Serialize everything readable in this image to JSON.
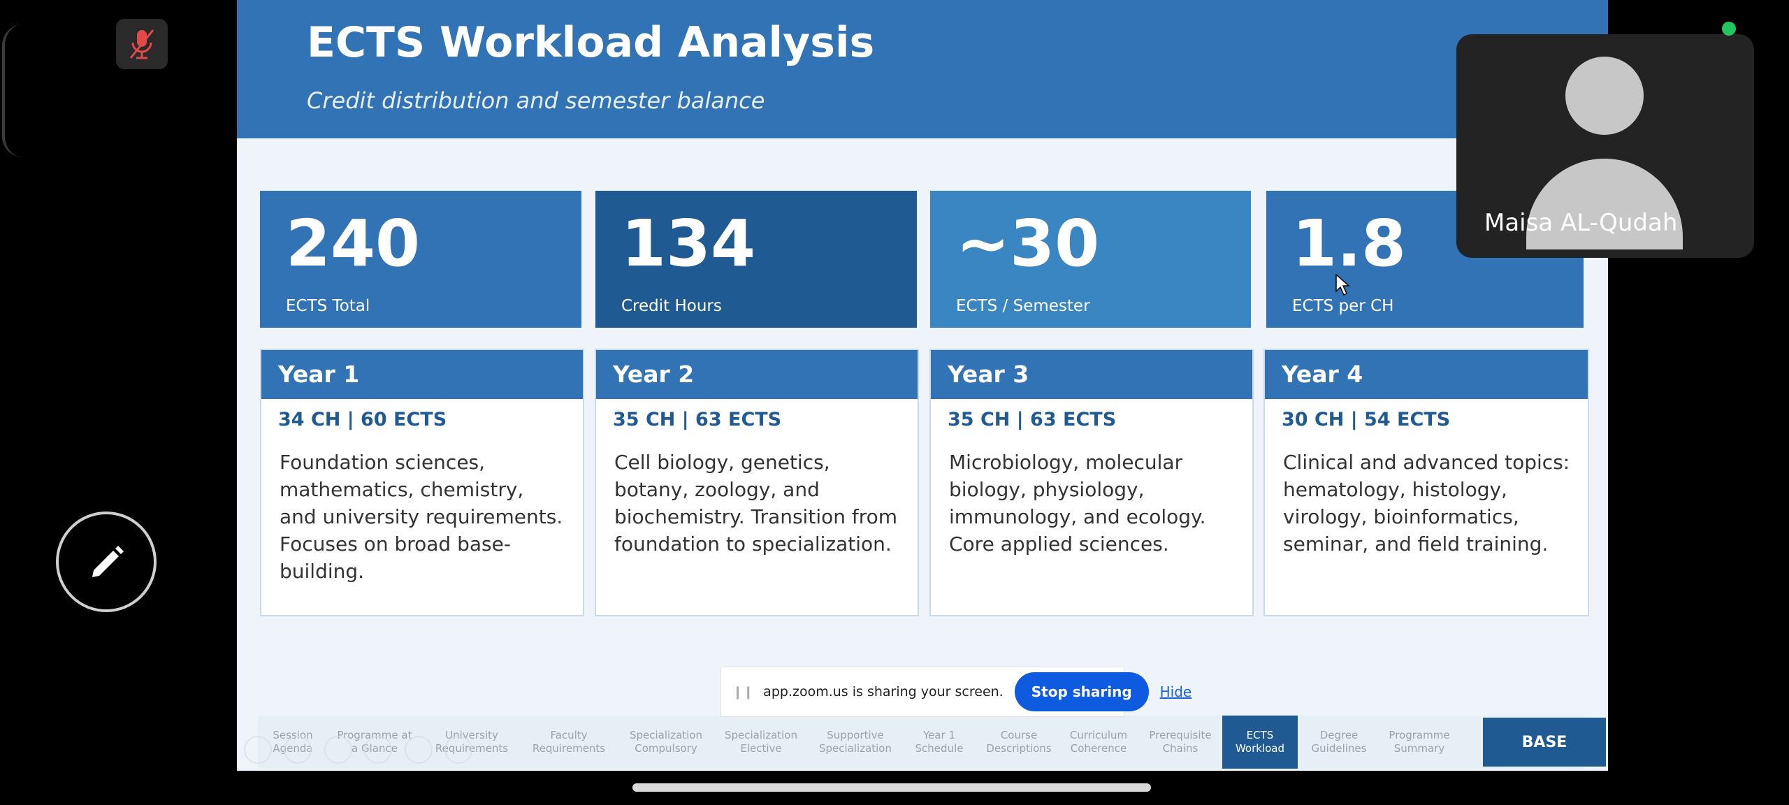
{
  "slide": {
    "title": "ECTS Workload Analysis",
    "subtitle": "Credit distribution and semester balance",
    "stats": [
      {
        "value": "240",
        "label": "ECTS Total",
        "color": "#3273b5"
      },
      {
        "value": "134",
        "label": "Credit Hours",
        "color": "#1f5a92"
      },
      {
        "value": "~30",
        "label": "ECTS / Semester",
        "color": "#3a86c2"
      },
      {
        "value": "1.8",
        "label": "ECTS per CH",
        "color": "#3273b5"
      }
    ],
    "years": [
      {
        "title": "Year 1",
        "credits": "34 CH | 60 ECTS",
        "description": "Foundation sciences, mathematics, chemistry, and university requirements. Focuses on broad base-building."
      },
      {
        "title": "Year 2",
        "credits": "35 CH | 63 ECTS",
        "description": "Cell biology, genetics, botany, zoology, and biochemistry. Transition from foundation to specialization."
      },
      {
        "title": "Year 3",
        "credits": "35 CH | 63 ECTS",
        "description": "Microbiology, molecular biology, physiology, immunology, and ecology. Core applied sciences."
      },
      {
        "title": "Year 4",
        "credits": "30 CH | 54 ECTS",
        "description": "Clinical and advanced topics: hematology, histology, virology, bioinformatics, seminar, and field training."
      }
    ]
  },
  "nav": {
    "items": [
      {
        "label": "Session Agenda"
      },
      {
        "label": "Programme at a Glance"
      },
      {
        "label": "University Requirements"
      },
      {
        "label": "Faculty Requirements"
      },
      {
        "label": "Specialization Compulsory"
      },
      {
        "label": "Specialization Elective"
      },
      {
        "label": "Supportive Specialization"
      },
      {
        "label": "Year 1 Schedule"
      },
      {
        "label": "Course Descriptions"
      },
      {
        "label": "Curriculum Coherence"
      },
      {
        "label": "Prerequisite Chains"
      },
      {
        "label": "ECTS Workload",
        "active": true
      },
      {
        "label": "Degree Guidelines"
      },
      {
        "label": "Programme Summary"
      }
    ],
    "base_label": "BASE"
  },
  "share_banner": {
    "message": "app.zoom.us is sharing your screen.",
    "stop_label": "Stop sharing",
    "hide_label": "Hide"
  },
  "participant": {
    "name": "Maisa AL-Qudah"
  },
  "icons": {
    "mute": "microphone-muted-icon",
    "annotate": "pencil-icon",
    "drag": "drag-handle-icon"
  },
  "colors": {
    "header_blue": "#3273b5",
    "dark_blue": "#1f5a92",
    "stop_button": "#0e5be0",
    "mute_red": "#e24a4a",
    "status_green": "#22c55e"
  }
}
